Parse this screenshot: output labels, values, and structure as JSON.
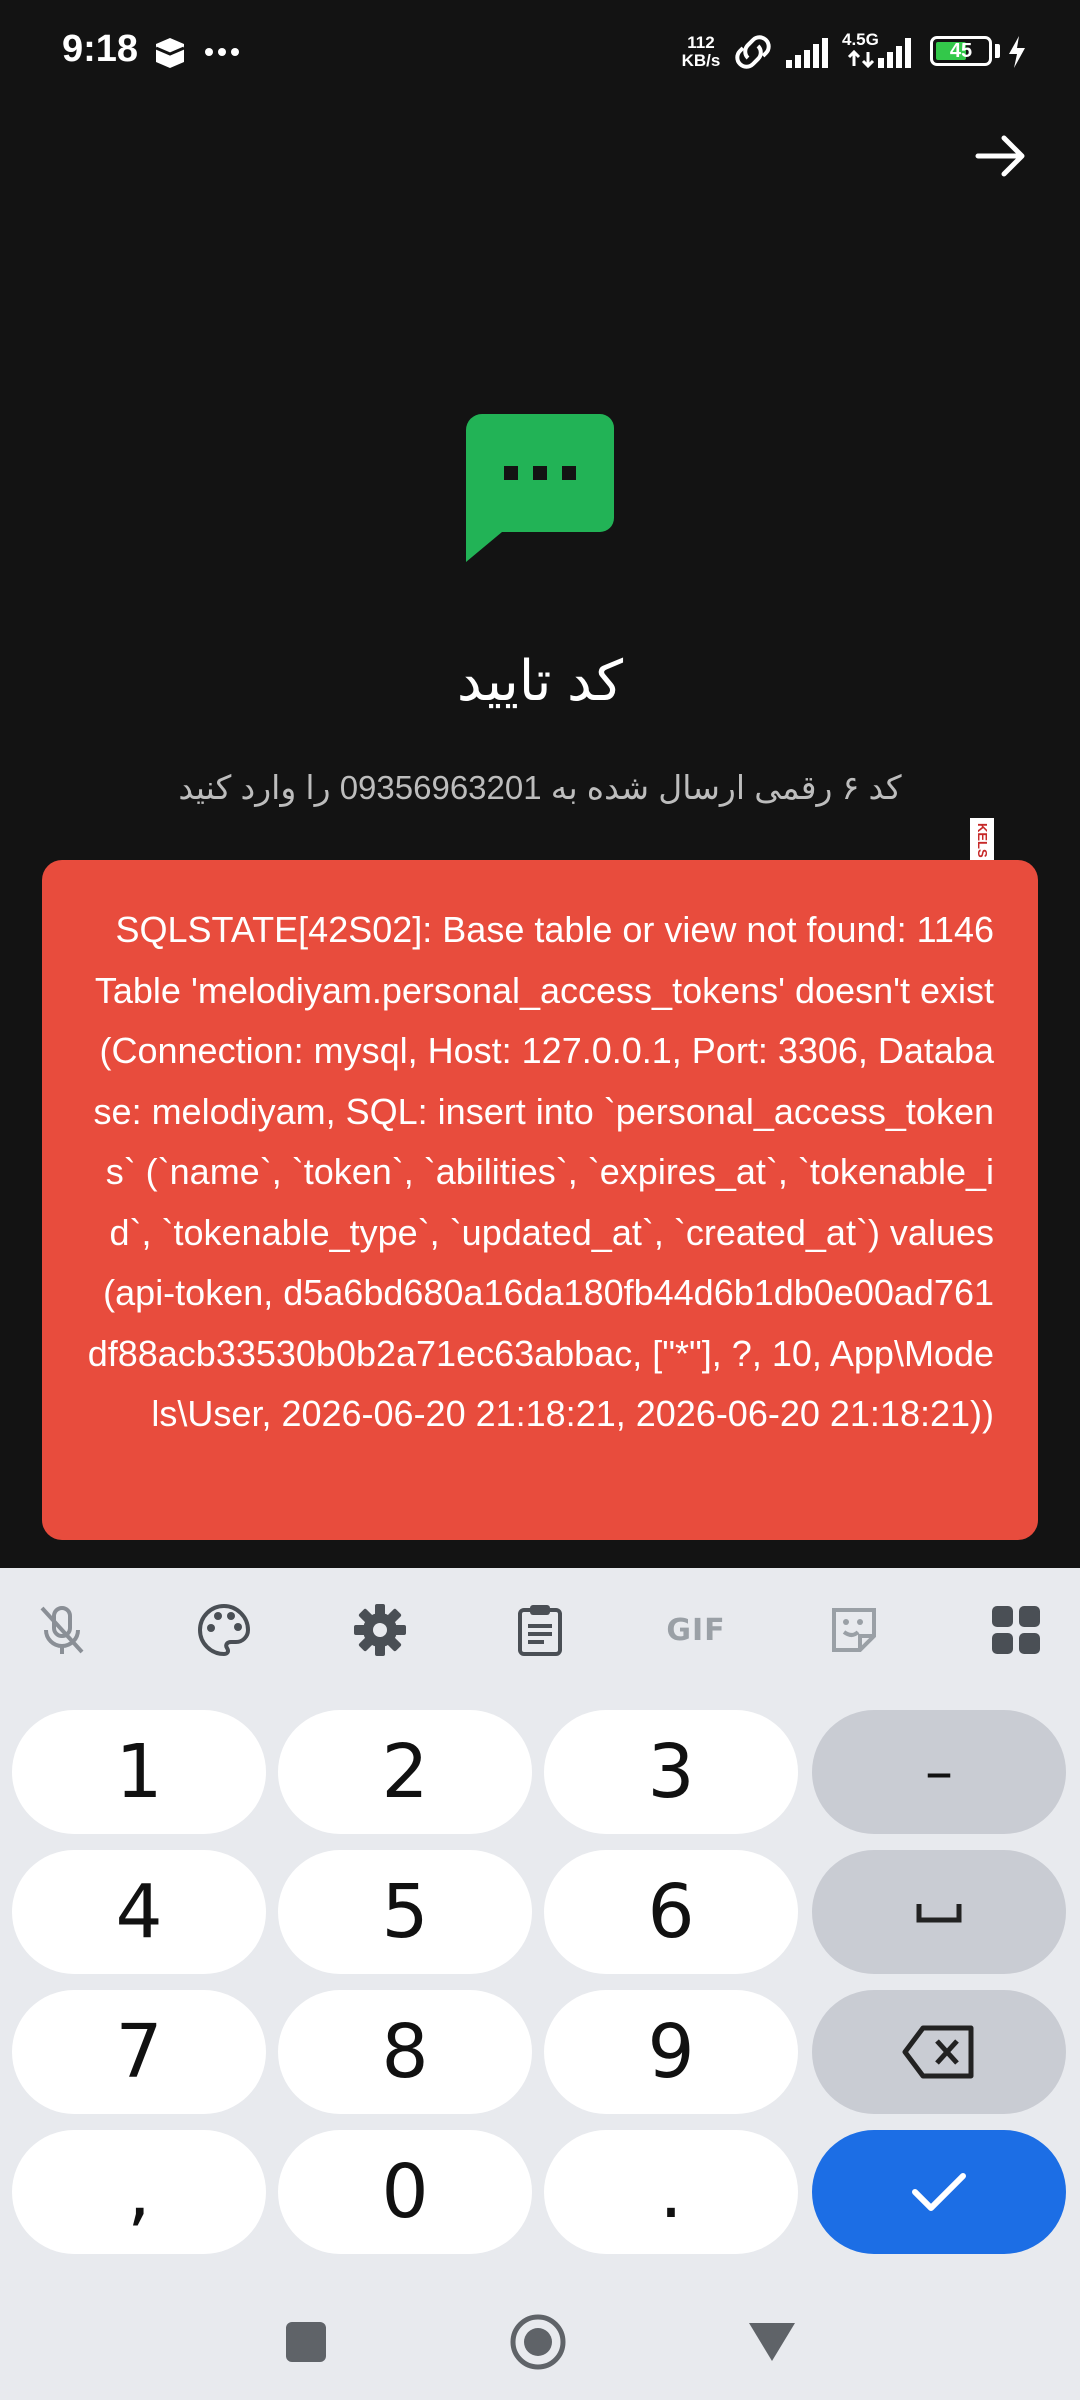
{
  "status_bar": {
    "time": "9:18",
    "net_speed_value": "112",
    "net_speed_unit": "KB/s",
    "network_type": "4.5G",
    "battery_level": "45"
  },
  "main": {
    "title": "کد تایید",
    "subtitle": "کد ۶ رقمی ارسال شده به 09356963201 را وارد کنید",
    "side_tag": "KELS"
  },
  "error_toast": {
    "message": "SQLSTATE[42S02]: Base table or view not found: 1146 Table 'melodiyam.personal_access_tokens' doesn't exist (Connection: mysql, Host: 127.0.0.1, Port: 3306, Database: melodiyam, SQL: insert into `personal_access_tokens` (`name`, `token`, `abilities`, `expires_at`, `tokenable_id`, `tokenable_type`, `updated_at`, `created_at`) values (api-token, d5a6bd680a16da180fb44d6b1db0e00ad761df88acb33530b0b2a71ec63abbac, [\"*\"], ?, 10, App\\Models\\User, 2026-06-20 21:18:21, 2026-06-20 21:18:21))"
  },
  "keyboard": {
    "toolbar_gif_label": "GIF",
    "keys": {
      "k1": "1",
      "k2": "2",
      "k3": "3",
      "minus": "–",
      "k4": "4",
      "k5": "5",
      "k6": "6",
      "space": "␣",
      "k7": "7",
      "k8": "8",
      "k9": "9",
      "comma": ",",
      "k0": "0",
      "period": "."
    }
  },
  "colors": {
    "background": "#131313",
    "accent_green": "#22b356",
    "error_red": "#e84c3d",
    "keyboard_bg": "#e8eaee",
    "enter_blue": "#1c6ee5",
    "battery_green": "#33c84a"
  }
}
